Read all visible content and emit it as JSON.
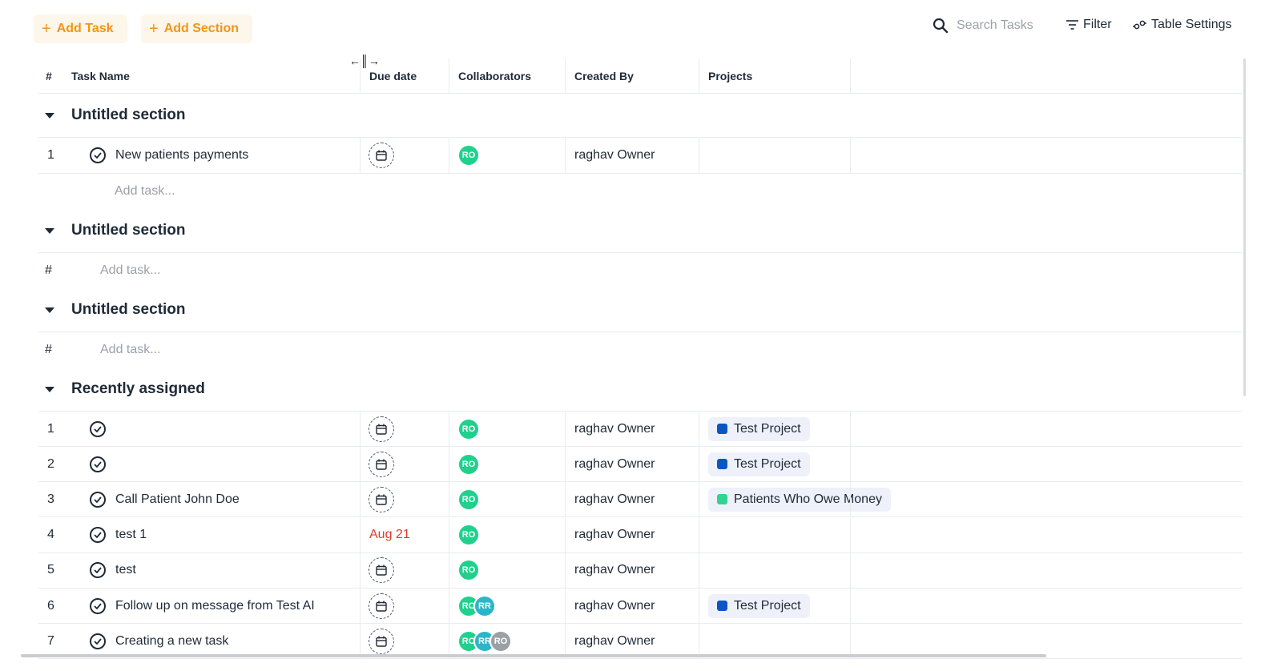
{
  "toolbar": {
    "add_task_label": "Add Task",
    "add_section_label": "Add Section",
    "search_placeholder": "Search Tasks",
    "filter_label": "Filter",
    "table_settings_label": "Table Settings"
  },
  "columns": {
    "num": "#",
    "task_name": "Task Name",
    "due_date": "Due date",
    "collaborators": "Collaborators",
    "created_by": "Created By",
    "projects": "Projects"
  },
  "sections": [
    {
      "title": "Untitled section",
      "add_task_label": "Add task...",
      "tasks": [
        {
          "num": "1",
          "name": "New patients payments",
          "due": "",
          "collaborators": [
            "RO"
          ],
          "created_by": "raghav Owner",
          "project": null
        }
      ]
    },
    {
      "title": "Untitled section",
      "add_task_label": "Add task...",
      "add_num": "#",
      "tasks": []
    },
    {
      "title": "Untitled section",
      "add_task_label": "Add task...",
      "add_num": "#",
      "tasks": []
    },
    {
      "title": "Recently assigned",
      "tasks": [
        {
          "num": "1",
          "name": "",
          "due": "",
          "collaborators": [
            "RO"
          ],
          "created_by": "raghav Owner",
          "project": {
            "name": "Test Project",
            "color": "#0a56c2"
          }
        },
        {
          "num": "2",
          "name": "",
          "due": "",
          "collaborators": [
            "RO"
          ],
          "created_by": "raghav Owner",
          "project": {
            "name": "Test Project",
            "color": "#0a56c2"
          }
        },
        {
          "num": "3",
          "name": "Call Patient John Doe",
          "due": "",
          "collaborators": [
            "RO"
          ],
          "created_by": "raghav Owner",
          "project": {
            "name": "Patients Who Owe Money",
            "color": "#2ed48f"
          }
        },
        {
          "num": "4",
          "name": "test 1",
          "due": "Aug 21",
          "collaborators": [
            "RO"
          ],
          "created_by": "raghav Owner",
          "project": null
        },
        {
          "num": "5",
          "name": "test",
          "due": "",
          "collaborators": [
            "RO"
          ],
          "created_by": "raghav Owner",
          "project": null
        },
        {
          "num": "6",
          "name": "Follow up on message from Test AI",
          "due": "",
          "collaborators": [
            "RO",
            "RR"
          ],
          "created_by": "raghav Owner",
          "project": {
            "name": "Test Project",
            "color": "#0a56c2"
          }
        },
        {
          "num": "7",
          "name": "Creating a new task",
          "due": "",
          "collaborators": [
            "RO",
            "RR",
            "RO"
          ],
          "created_by": "raghav Owner",
          "project": null
        }
      ]
    }
  ],
  "colors": {
    "accent": "#f0961a",
    "avatar_ro": "#1fd18d",
    "avatar_rr": "#2bb5c9",
    "overdue": "#e03b2b"
  }
}
